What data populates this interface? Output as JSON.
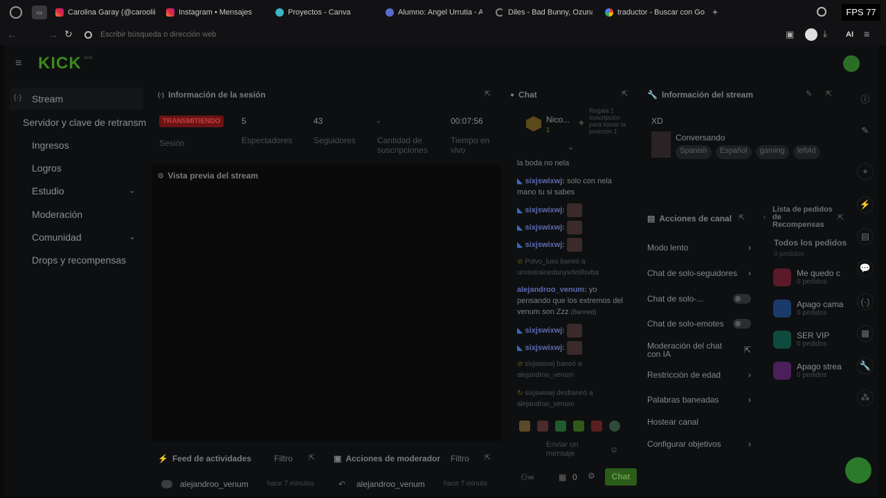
{
  "browser": {
    "tabs": [
      {
        "title": "Carolina Garay (@caroolii",
        "favicon": "instagram-icon"
      },
      {
        "title": "Instagram • Mensajes",
        "favicon": "instagram-icon"
      },
      {
        "title": "Proyectos - Canva",
        "favicon": "canva-icon"
      },
      {
        "title": "Alumno: Angel Urrutia - A",
        "favicon": "school-icon"
      },
      {
        "title": "Diles - Bad Bunny, Ozuna,",
        "favicon": "loading-icon"
      },
      {
        "title": "traductor - Buscar con Go",
        "favicon": "google-icon"
      }
    ],
    "new_tab": "+",
    "fps": "FPS 77",
    "url_placeholder": "Escribir búsqueda o dirección web",
    "ai_label": "AI"
  },
  "kick": {
    "logo": "KICK",
    "logo_badge": "beta"
  },
  "nav": {
    "stream": "Stream",
    "server_key": "Servidor y clave de retransm",
    "ingresos": "Ingresos",
    "logros": "Logros",
    "estudio": "Estudio",
    "moderacion": "Moderación",
    "comunidad": "Comunidad",
    "drops": "Drops y recompensas",
    "gx": "GX",
    "more": "..."
  },
  "session": {
    "title": "Información de la sesión",
    "status": "TRANSMITIENDO",
    "status_label": "Sesión",
    "stats": [
      {
        "value": "5",
        "label": "Espectadores"
      },
      {
        "value": "43",
        "label": "Seguidores"
      },
      {
        "value": "-",
        "label": "Cantidad de suscripciones"
      },
      {
        "value": "00:07:56",
        "label": "Tiempo en vivo"
      }
    ]
  },
  "preview": {
    "title": "Vista previa del stream"
  },
  "chat": {
    "title": "Chat",
    "pinned_user": "Nico...",
    "pinned_count": "1",
    "pinned_msg": "Regala 1 suscripción para tomar la posición 1",
    "messages": [
      {
        "user": "",
        "text": "la boda no nela"
      },
      {
        "user": "sixjswixwj:",
        "text": "solo con nela mano tu si sabes"
      },
      {
        "user": "sixjswixwj:",
        "text": ""
      },
      {
        "user": "sixjswixwj:",
        "text": ""
      },
      {
        "user": "sixjswixwj:",
        "text": ""
      },
      {
        "user": "Polvo_luss",
        "text": "baneó a unrestrainedonyxrfe9fsvba"
      },
      {
        "user": "alejandroo_venum:",
        "text": "yo pensando que los extremos del venum son Zzz",
        "tag": "(Banned)"
      },
      {
        "user": "sixjswixwj:",
        "text": ""
      },
      {
        "user": "sixjswixwj:",
        "text": ""
      },
      {
        "user": "sixjswixwj",
        "text": "baneó a alejandroo_venum"
      },
      {
        "user": "sixjswixwj",
        "text": "desbaneó a alejandroo_venum"
      }
    ],
    "input_placeholder": "Enviar un mensaje",
    "points": "0",
    "send": "Chat"
  },
  "stream_info": {
    "title": "Información del stream",
    "stream_title": "XD",
    "category": "Conversando",
    "tags": [
      "Spanish",
      "Español",
      "gaming",
      "left4d"
    ]
  },
  "channel_actions": {
    "title": "Acciones de canal",
    "items": [
      {
        "label": "Modo lento",
        "control": "chevron"
      },
      {
        "label": "Chat de solo-seguidores",
        "control": "chevron"
      },
      {
        "label": "Chat de solo-...",
        "control": "toggle"
      },
      {
        "label": "Chat de solo-emotes",
        "control": "toggle"
      },
      {
        "label": "Moderación del chat con IA",
        "control": "external"
      },
      {
        "label": "Restricción de edad",
        "control": "chevron"
      },
      {
        "label": "Palabras baneadas",
        "control": "chevron"
      },
      {
        "label": "Hostear canal",
        "control": "none"
      },
      {
        "label": "Configurar objetivos",
        "control": "chevron"
      }
    ]
  },
  "rewards": {
    "title": "Lista de pedidos de Recompensas",
    "all": "Todos los pedidos",
    "all_sub": "0 pedidos",
    "items": [
      {
        "title": "Me quedo c",
        "sub": "0 pedidos",
        "color": "#7a1f3a"
      },
      {
        "title": "Apago cama",
        "sub": "0 pedidos",
        "color": "#1f4a8a"
      },
      {
        "title": "SER VIP",
        "sub": "0 pedidos",
        "color": "#0f6a5a"
      },
      {
        "title": "Apago strea",
        "sub": "0 pedidos",
        "color": "#5a2a7a"
      }
    ]
  },
  "activity": {
    "title": "Feed de actividades",
    "filter": "Filtro",
    "user": "alejandroo_venum",
    "time": "hace 7 minutos"
  },
  "mod_actions": {
    "title": "Acciones de moderador",
    "filter": "Filtro",
    "user": "alejandroo_venum",
    "time": "hace 7 minuto"
  }
}
